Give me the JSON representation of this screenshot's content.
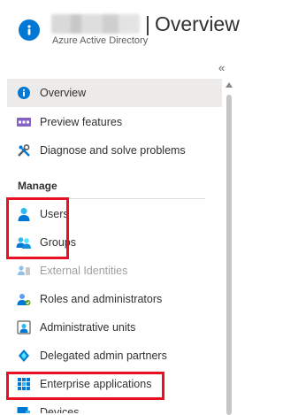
{
  "header": {
    "title_separator": "|",
    "title": "Overview",
    "subtitle": "Azure Active Directory"
  },
  "collapse_label": "«",
  "nav": {
    "top_items": [
      {
        "label": "Overview",
        "icon": "info-icon",
        "active": true
      },
      {
        "label": "Preview features",
        "icon": "preview-features-icon"
      },
      {
        "label": "Diagnose and solve problems",
        "icon": "wrench-icon"
      }
    ],
    "manage_title": "Manage",
    "manage_items": [
      {
        "label": "Users",
        "icon": "user-icon",
        "highlighted": true
      },
      {
        "label": "Groups",
        "icon": "groups-icon",
        "highlighted": true
      },
      {
        "label": "External Identities",
        "icon": "external-identities-icon",
        "disabled": true
      },
      {
        "label": "Roles and administrators",
        "icon": "roles-icon"
      },
      {
        "label": "Administrative units",
        "icon": "admin-units-icon"
      },
      {
        "label": "Delegated admin partners",
        "icon": "delegated-partners-icon"
      },
      {
        "label": "Enterprise applications",
        "icon": "enterprise-apps-icon",
        "highlighted": true
      },
      {
        "label": "Devices",
        "icon": "devices-icon"
      }
    ]
  },
  "colors": {
    "accent": "#0078d4",
    "active_bg": "#edebe9",
    "highlight_border": "#e81123",
    "disabled_text": "#a19f9d"
  }
}
